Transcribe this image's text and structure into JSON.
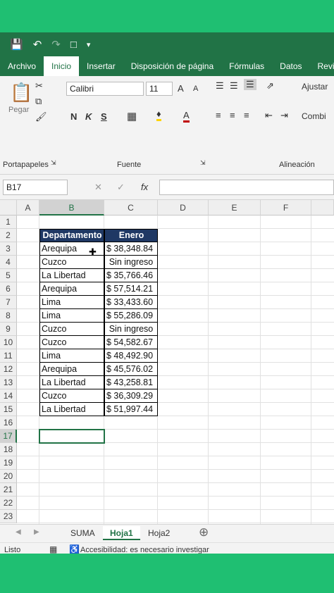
{
  "qat": {
    "save_icon": "save-icon",
    "undo_icon": "undo-icon",
    "redo_icon": "redo-icon",
    "new_icon": "new-doc-icon",
    "customize": "▾"
  },
  "tabs": [
    "Archivo",
    "Inicio",
    "Insertar",
    "Disposición de página",
    "Fórmulas",
    "Datos",
    "Revisar"
  ],
  "ribbon": {
    "paste_label": "Pegar",
    "clipboard_group": "Portapapeles",
    "font_name": "Calibri",
    "font_size": "11",
    "font_group": "Fuente",
    "align_group": "Alineación",
    "wrap_label": "Ajustar",
    "merge_label": "Combi",
    "bold": "N",
    "italic": "K",
    "underline": "S",
    "grow": "A",
    "shrink": "A",
    "font_color": "A"
  },
  "formula_bar": {
    "name_box": "B17",
    "cancel": "✕",
    "enter": "✓",
    "fx": "fx",
    "value": ""
  },
  "columns": [
    "A",
    "B",
    "C",
    "D",
    "E",
    "F"
  ],
  "rows": [
    "1",
    "2",
    "3",
    "4",
    "5",
    "6",
    "7",
    "8",
    "9",
    "10",
    "11",
    "12",
    "13",
    "14",
    "15",
    "16",
    "17",
    "18",
    "19",
    "20",
    "21",
    "22",
    "23"
  ],
  "table": {
    "headers": [
      "Departamento",
      "Enero"
    ],
    "rows": [
      [
        "Arequipa",
        "$ 38,348.84"
      ],
      [
        "Cuzco",
        "Sin ingreso"
      ],
      [
        "La Libertad",
        "$ 35,766.46"
      ],
      [
        "Arequipa",
        "$ 57,514.21"
      ],
      [
        "Lima",
        "$ 33,433.60"
      ],
      [
        "Lima",
        "$ 55,286.09"
      ],
      [
        "Cuzco",
        "Sin ingreso"
      ],
      [
        "Cuzco",
        "$ 54,582.67"
      ],
      [
        "Lima",
        "$ 48,492.90"
      ],
      [
        "Arequipa",
        "$ 45,576.02"
      ],
      [
        "La Libertad",
        "$ 43,258.81"
      ],
      [
        "Cuzco",
        "$ 36,309.29"
      ],
      [
        "La Libertad",
        "$ 51,997.44"
      ]
    ]
  },
  "sheets": [
    "SUMA",
    "Hoja1",
    "Hoja2"
  ],
  "active_sheet": "Hoja1",
  "status": {
    "ready": "Listo",
    "accessibility": "Accesibilidad: es necesario investigar"
  }
}
